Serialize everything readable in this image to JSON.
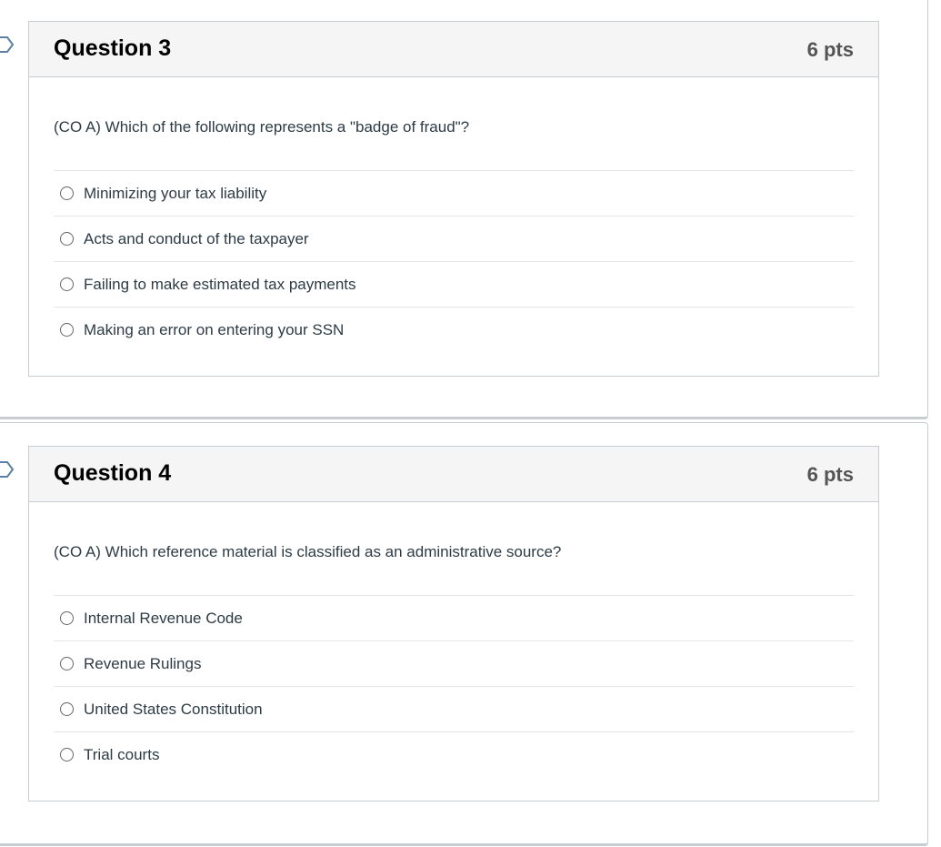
{
  "questions": [
    {
      "title": "Question 3",
      "points": "6 pts",
      "text": "(CO A) Which of the following represents a \"badge of fraud\"?",
      "answers": [
        "Minimizing your tax liability",
        "Acts and conduct of the taxpayer",
        "Failing to make estimated tax payments",
        "Making an error on entering your SSN"
      ]
    },
    {
      "title": "Question 4",
      "points": "6 pts",
      "text": "(CO A) Which reference material is classified as an administrative source?",
      "answers": [
        "Internal Revenue Code",
        "Revenue Rulings",
        "United States Constitution",
        "Trial courts"
      ]
    }
  ],
  "icons": {
    "flag": "flag-question-icon",
    "radio": "radio-unselected-icon"
  },
  "colors": {
    "header_bg": "#f5f5f5",
    "border": "#c7cdd1",
    "title": "#000000",
    "points": "#555555",
    "text": "#2d3b45",
    "flag": "#5c7fa3"
  }
}
